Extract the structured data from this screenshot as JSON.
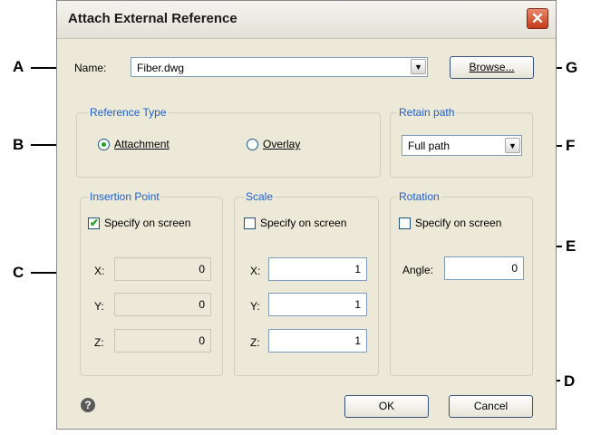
{
  "dialog": {
    "title": "Attach External Reference",
    "close_glyph": "✕"
  },
  "name_row": {
    "label": "Name:",
    "value": "Fiber.dwg",
    "browse_label": "Browse..."
  },
  "reference_type": {
    "title": "Reference Type",
    "attachment_label": "Attachment",
    "overlay_label": "Overlay",
    "selected": "Attachment"
  },
  "retain_path": {
    "title": "Retain path",
    "value": "Full path"
  },
  "insertion_point": {
    "title": "Insertion Point",
    "specify_label": "Specify on screen",
    "specify_checked": true,
    "x_label": "X:",
    "x_value": "0",
    "y_label": "Y:",
    "y_value": "0",
    "z_label": "Z:",
    "z_value": "0"
  },
  "scale": {
    "title": "Scale",
    "specify_label": "Specify on screen",
    "specify_checked": false,
    "x_label": "X:",
    "x_value": "1",
    "y_label": "Y:",
    "y_value": "1",
    "z_label": "Z:",
    "z_value": "1"
  },
  "rotation": {
    "title": "Rotation",
    "specify_label": "Specify on screen",
    "specify_checked": false,
    "angle_label": "Angle:",
    "angle_value": "0"
  },
  "footer": {
    "help_glyph": "?",
    "ok_label": "OK",
    "cancel_label": "Cancel"
  },
  "callouts": {
    "A": "A",
    "B": "B",
    "C": "C",
    "D": "D",
    "E": "E",
    "F": "F",
    "G": "G"
  },
  "colors": {
    "accent_label": "#1d5fcf",
    "check_green": "#21a121",
    "close_red": "#c4391a"
  }
}
